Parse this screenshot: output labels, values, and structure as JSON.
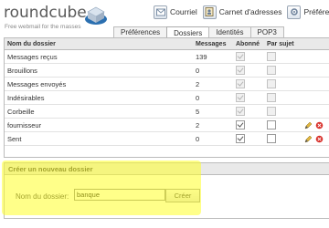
{
  "logo": {
    "name": "roundcube",
    "tagline": "Free webmail for the masses"
  },
  "topnav": [
    {
      "label": "Courriel",
      "icon": "mail-icon"
    },
    {
      "label": "Carnet d'adresses",
      "icon": "address-book-icon"
    },
    {
      "label": "Préférences",
      "icon": "settings-icon"
    }
  ],
  "tabs": [
    "Préférences",
    "Dossiers",
    "Identités",
    "POP3"
  ],
  "active_tab": "Dossiers",
  "table": {
    "headers": [
      "Nom du dossier",
      "Messages",
      "Abonné",
      "Par sujet"
    ],
    "rows": [
      {
        "name": "Messages reçus",
        "messages": "139",
        "subscribed": true,
        "threaded": false,
        "editable": false
      },
      {
        "name": "Brouillons",
        "messages": "0",
        "subscribed": true,
        "threaded": false,
        "editable": false
      },
      {
        "name": "Messages envoyés",
        "messages": "2",
        "subscribed": true,
        "threaded": false,
        "editable": false
      },
      {
        "name": "Indésirables",
        "messages": "0",
        "subscribed": true,
        "threaded": false,
        "editable": false
      },
      {
        "name": "Corbeille",
        "messages": "5",
        "subscribed": true,
        "threaded": false,
        "editable": false
      },
      {
        "name": "fournisseur",
        "messages": "2",
        "subscribed": true,
        "threaded": false,
        "editable": true
      },
      {
        "name": "Sent",
        "messages": "0",
        "subscribed": true,
        "threaded": false,
        "editable": true
      }
    ]
  },
  "create": {
    "title": "Créer un nouveau dossier",
    "label": "Nom du dossier:",
    "value": "banque",
    "button": "Créer"
  },
  "colors": {
    "highlight": "#ffff28",
    "header_bg": "#e9e9e9",
    "border": "#bbbbbb"
  }
}
